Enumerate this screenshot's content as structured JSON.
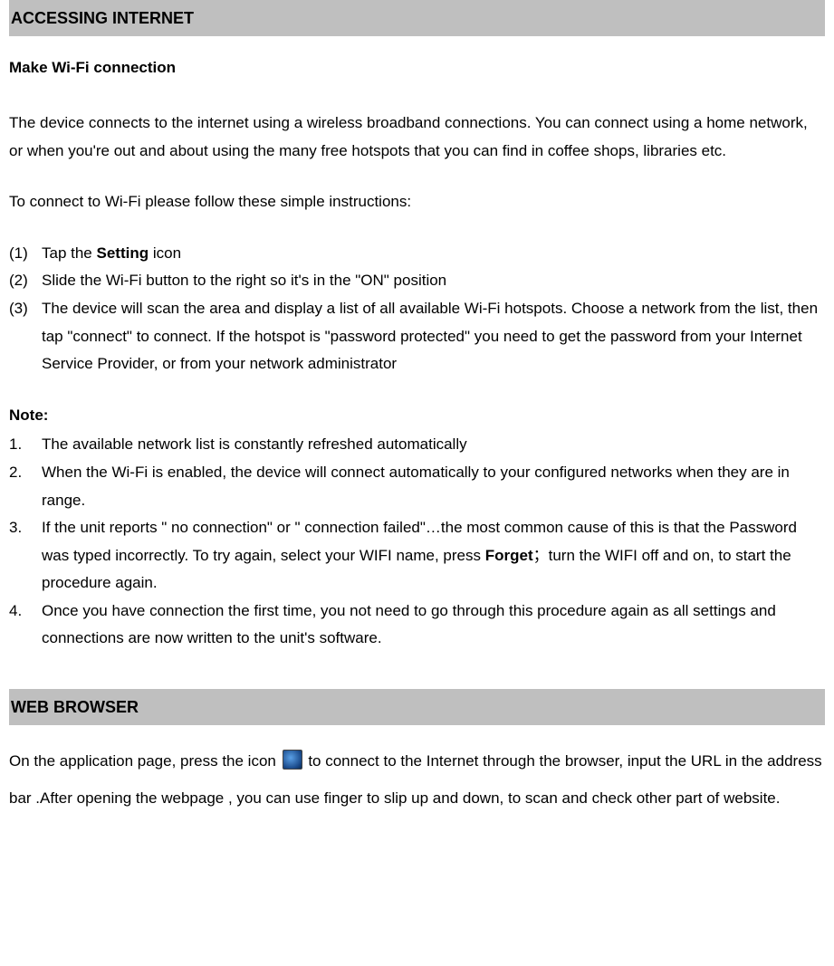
{
  "section1": {
    "header": "ACCESSING INTERNET",
    "subheading": "Make Wi-Fi connection",
    "intro": "The device connects to the internet using a wireless broadband connections. You can connect using a home network, or when you're out and about using the many free hotspots that you can find in coffee shops, libraries etc.",
    "instrIntro": "To connect to Wi-Fi please follow these simple instructions:",
    "steps": {
      "s1_num": "(1)",
      "s1_pre": "Tap the ",
      "s1_bold": "Setting",
      "s1_post": " icon",
      "s2_num": "(2)",
      "s2": "Slide the Wi-Fi button to the right so it's in the \"ON\" position",
      "s3_num": "(3)",
      "s3": "The device will scan the area and display a list of all available Wi-Fi hotspots. Choose a network from the list, then tap \"connect\" to connect. If the hotspot is \"password protected\" you need to get the password from your Internet Service Provider, or from your network administrator"
    },
    "noteLabel": "Note:",
    "notes": {
      "n1_num": "1.",
      "n1": "The available network list is constantly refreshed automatically",
      "n2_num": "2.",
      "n2": "When the Wi-Fi is enabled, the device will connect automatically to your configured networks when they are in range.",
      "n3_num": "3.",
      "n3_pre": "If the unit reports \" no connection\" or \" connection failed\"…the most common cause of this is that the Password was typed incorrectly. To try again, select your WIFI name, press ",
      "n3_bold": "Forget",
      "n3_post": "；turn the WIFI off and on, to start the procedure again.",
      "n4_num": "4.",
      "n4": "Once you have connection the first time, you not need to go through this procedure again as all settings and connections are now written to the unit's software."
    }
  },
  "section2": {
    "header": "WEB BROWSER",
    "para_pre": "On the application page, press the icon ",
    "para_post": " to connect to the Internet through the browser, input the URL in the address bar .After opening the webpage , you can use finger to slip up and down, to scan and check other part of website."
  }
}
